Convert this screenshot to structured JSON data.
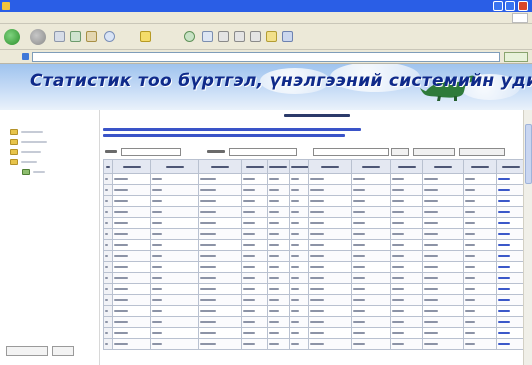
{
  "window": {
    "title": "",
    "accent": "#2a5ee6"
  },
  "menubar": {
    "items": [
      "",
      "",
      "",
      "",
      "",
      ""
    ]
  },
  "address": {
    "url": "",
    "go_label": ""
  },
  "banner": {
    "title": "Статистик тоо бүртгэл, үнэлгээний системийн удирдлагын хэсэг",
    "title_color": "#0f2a8a"
  },
  "sidebar": {
    "tree": [
      "",
      "",
      "",
      "",
      ""
    ],
    "buttons": [
      "",
      ""
    ]
  },
  "main": {
    "page_title": "",
    "info": [
      "",
      ""
    ],
    "filters": {
      "label1": "",
      "input1": "",
      "label2": "",
      "input2": "",
      "select_value": "",
      "btn1": "",
      "btn2": "",
      "btn3": ""
    },
    "table": {
      "headers": [
        "",
        "",
        "",
        "",
        "",
        "",
        "",
        "",
        "",
        "",
        "",
        "",
        ""
      ],
      "rows": [
        [
          "",
          "",
          "",
          "",
          "",
          "",
          "",
          "",
          "",
          "",
          "",
          "",
          ""
        ],
        [
          "",
          "",
          "",
          "",
          "",
          "",
          "",
          "",
          "",
          "",
          "",
          "",
          ""
        ],
        [
          "",
          "",
          "",
          "",
          "",
          "",
          "",
          "",
          "",
          "",
          "",
          "",
          ""
        ],
        [
          "",
          "",
          "",
          "",
          "",
          "",
          "",
          "",
          "",
          "",
          "",
          "",
          ""
        ],
        [
          "",
          "",
          "",
          "",
          "",
          "",
          "",
          "",
          "",
          "",
          "",
          "",
          ""
        ],
        [
          "",
          "",
          "",
          "",
          "",
          "",
          "",
          "",
          "",
          "",
          "",
          "",
          ""
        ],
        [
          "",
          "",
          "",
          "",
          "",
          "",
          "",
          "",
          "",
          "",
          "",
          "",
          ""
        ],
        [
          "",
          "",
          "",
          "",
          "",
          "",
          "",
          "",
          "",
          "",
          "",
          "",
          ""
        ],
        [
          "",
          "",
          "",
          "",
          "",
          "",
          "",
          "",
          "",
          "",
          "",
          "",
          ""
        ],
        [
          "",
          "",
          "",
          "",
          "",
          "",
          "",
          "",
          "",
          "",
          "",
          "",
          ""
        ],
        [
          "",
          "",
          "",
          "",
          "",
          "",
          "",
          "",
          "",
          "",
          "",
          "",
          ""
        ],
        [
          "",
          "",
          "",
          "",
          "",
          "",
          "",
          "",
          "",
          "",
          "",
          "",
          ""
        ],
        [
          "",
          "",
          "",
          "",
          "",
          "",
          "",
          "",
          "",
          "",
          "",
          "",
          ""
        ],
        [
          "",
          "",
          "",
          "",
          "",
          "",
          "",
          "",
          "",
          "",
          "",
          "",
          ""
        ],
        [
          "",
          "",
          "",
          "",
          "",
          "",
          "",
          "",
          "",
          "",
          "",
          "",
          ""
        ],
        [
          "",
          "",
          "",
          "",
          "",
          "",
          "",
          "",
          "",
          "",
          "",
          "",
          ""
        ]
      ]
    }
  }
}
